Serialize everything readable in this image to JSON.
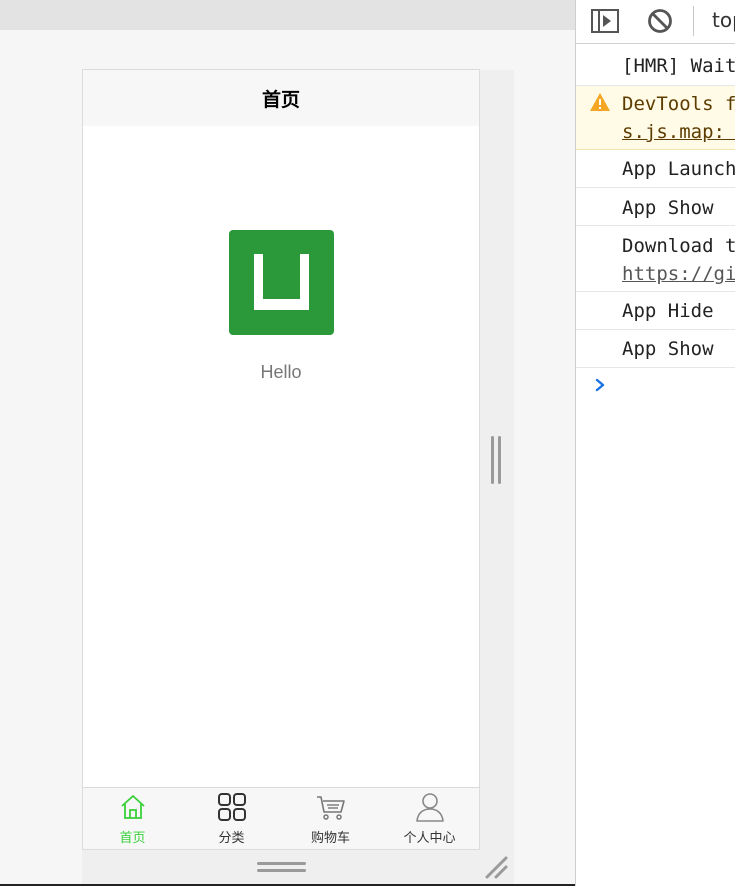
{
  "phone": {
    "nav_title": "首页",
    "hello_text": "Hello",
    "logo_icon": "uni-app-logo-icon",
    "logo_color": "#2b9939",
    "tabs": [
      {
        "label": "首页",
        "icon": "home-icon",
        "active": true
      },
      {
        "label": "分类",
        "icon": "grid-icon",
        "active": false
      },
      {
        "label": "购物车",
        "icon": "cart-icon",
        "active": false
      },
      {
        "label": "个人中心",
        "icon": "user-icon",
        "active": false
      }
    ],
    "active_color": "#39d039"
  },
  "devtools": {
    "toolbar": {
      "sidebar_icon": "show-sidebar-icon",
      "clear_icon": "clear-console-icon",
      "context_label": "top"
    },
    "logs": [
      {
        "text": "[HMR] Waiting for update signal from WDS...",
        "level": "log"
      },
      {
        "text": "DevTools failed to load source map",
        "link": "s.js.map: ...",
        "level": "warning"
      },
      {
        "text": "App Launch",
        "level": "log"
      },
      {
        "text": "App Show",
        "level": "log"
      },
      {
        "text": "Download the Vue Devtools extension",
        "link": "https://github.com/vuejs/vue-devtools",
        "level": "log"
      },
      {
        "text": "App Hide",
        "level": "log"
      },
      {
        "text": "App Show",
        "level": "log"
      }
    ],
    "warning_color": "#f5a623",
    "prompt_icon": "console-prompt-icon"
  }
}
